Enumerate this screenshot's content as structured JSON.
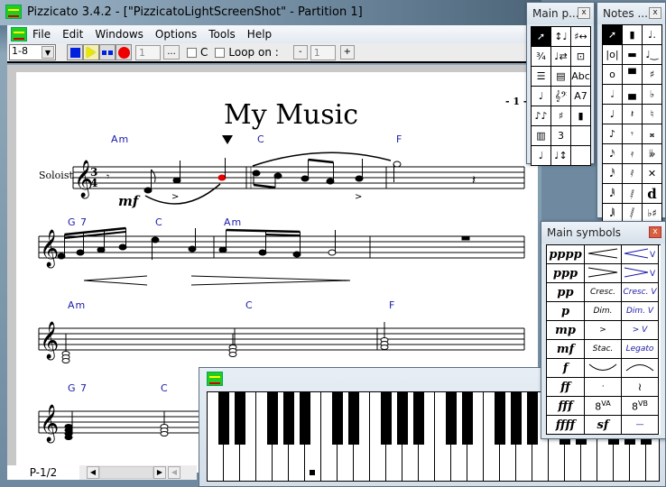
{
  "window": {
    "title": "Pizzicato 3.4.2 - [\"PizzicatoLightScreenShot\" - Partition 1]"
  },
  "menu": [
    "File",
    "Edit",
    "Windows",
    "Options",
    "Tools",
    "Help"
  ],
  "toolbar": {
    "measure_range": "1-8",
    "tempo_field": "1",
    "ellipsis_label": "...",
    "c_checkbox_label": "C",
    "loop_label": "Loop on :",
    "minus_label": "-",
    "loop_field": "1",
    "plus_label": "+"
  },
  "score": {
    "title": "My Music",
    "page_marker": "- 1 -",
    "instrument": "Soloist",
    "time_signature": "3/4",
    "dynamic": "mf",
    "chords_row1": [
      "Am",
      "C",
      "F"
    ],
    "chords_row2": [
      "G 7",
      "C",
      "Am"
    ],
    "chords_row3": [
      "Am",
      "C",
      "F"
    ],
    "chords_row4": [
      "G 7",
      "C"
    ],
    "selected_note_color": "#e00000",
    "chord_color": "#1a1aa8"
  },
  "status": {
    "page_indicator": "P-1/2"
  },
  "main_palette": {
    "title": "Main p...",
    "close": "x",
    "cells": [
      "arrow-tool",
      "pitch-la",
      "transpose",
      "3/4",
      "la-shift",
      "measure-layout",
      "multi-staff",
      "text-block",
      "Abc",
      "note-stems",
      "clefs",
      "A7",
      "eighth-pair",
      "staff-lines",
      "voice",
      "keyboard-0-8",
      "triplet-3",
      "",
      "note-la",
      "note-move",
      ""
    ]
  },
  "notes_palette": {
    "title": "Notes ...",
    "close": "x",
    "cells": [
      "arrow-tool",
      "quarter-rest-bar",
      "dotted-note",
      "repeat-bar",
      "half-rest",
      "tie",
      "whole-note",
      "whole-rest",
      "sharp",
      "half-note",
      "half-rest-2",
      "flat",
      "quarter-note",
      "quarter-rest",
      "natural",
      "eighth-note",
      "eighth-rest",
      "double-sharp",
      "sixteenth-note",
      "sixteenth-rest",
      "double-flat",
      "32nd-note",
      "32nd-rest",
      "cancel",
      "64th-note",
      "64th-rest",
      "d",
      "128th-note",
      "128th-rest",
      "enharmonic"
    ]
  },
  "symbols_palette": {
    "title": "Main symbols",
    "close": "x",
    "rows": [
      [
        "pppp",
        "crescendo-hairpin",
        "crescendo-hairpin-v"
      ],
      [
        "ppp",
        "decrescendo-hairpin",
        "decrescendo-hairpin-v"
      ],
      [
        "pp",
        "Cresc.",
        "Cresc. V"
      ],
      [
        "p",
        "Dim.",
        "Dim. V"
      ],
      [
        "mp",
        ">",
        "> V"
      ],
      [
        "mf",
        "Stac.",
        "Legato"
      ],
      [
        "f",
        "slur-down",
        "slur-up"
      ],
      [
        "ff",
        "·",
        "turn"
      ],
      [
        "fff",
        "8VA",
        "8VB"
      ],
      [
        "ffff",
        "sf",
        "—"
      ]
    ]
  },
  "piano": {
    "marked_key_index": 6
  }
}
